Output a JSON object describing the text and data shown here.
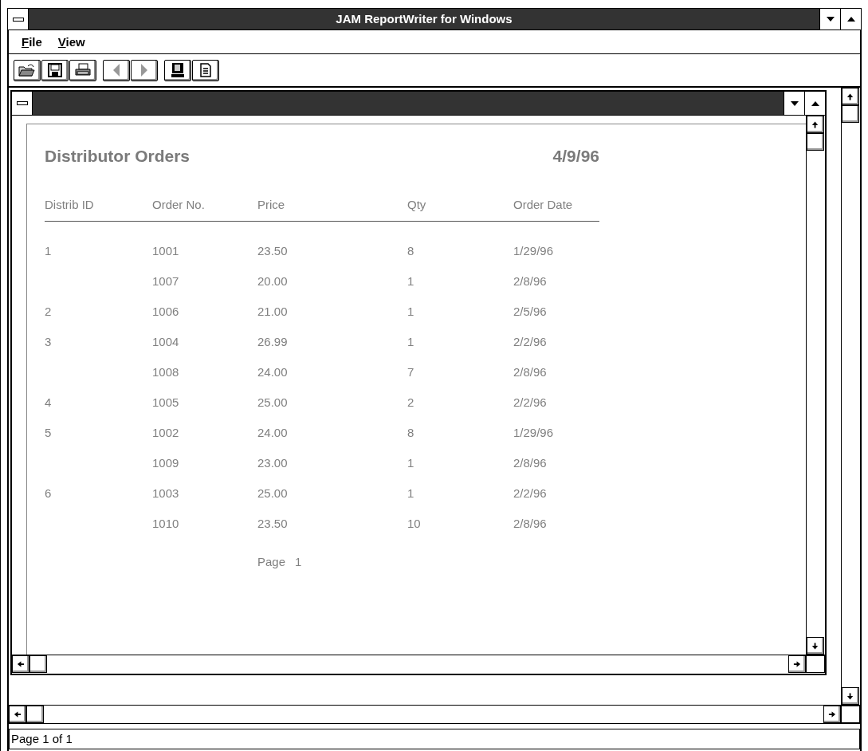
{
  "window": {
    "title": "JAM ReportWriter for Windows"
  },
  "menu": [
    {
      "label": "File"
    },
    {
      "label": "View"
    }
  ],
  "toolbar": [
    {
      "kind": "open",
      "disabled": false
    },
    {
      "kind": "save",
      "disabled": false
    },
    {
      "kind": "print",
      "disabled": false
    },
    {
      "kind": "previous",
      "disabled": true
    },
    {
      "kind": "next",
      "disabled": true
    },
    {
      "kind": "screen",
      "disabled": false
    },
    {
      "kind": "document",
      "disabled": false
    }
  ],
  "report": {
    "title": "Distributor Orders",
    "date": "4/9/96",
    "columns": [
      "Distrib ID",
      "Order No.",
      "Price",
      "Qty",
      "Order Date"
    ],
    "rows": [
      [
        "1",
        "1001",
        "23.50",
        "8",
        "1/29/96"
      ],
      [
        "",
        "1007",
        "20.00",
        "1",
        "2/8/96"
      ],
      [
        "2",
        "1006",
        "21.00",
        "1",
        "2/5/96"
      ],
      [
        "3",
        "1004",
        "26.99",
        "1",
        "2/2/96"
      ],
      [
        "",
        "1008",
        "24.00",
        "7",
        "2/8/96"
      ],
      [
        "4",
        "1005",
        "25.00",
        "2",
        "2/2/96"
      ],
      [
        "5",
        "1002",
        "24.00",
        "8",
        "1/29/96"
      ],
      [
        "",
        "1009",
        "23.00",
        "1",
        "2/8/96"
      ],
      [
        "6",
        "1003",
        "25.00",
        "1",
        "2/2/96"
      ],
      [
        "",
        "1010",
        "23.50",
        "10",
        "2/8/96"
      ]
    ],
    "footer_label": "Page",
    "footer_number": "1"
  },
  "status_bar": "Page 1 of 1"
}
